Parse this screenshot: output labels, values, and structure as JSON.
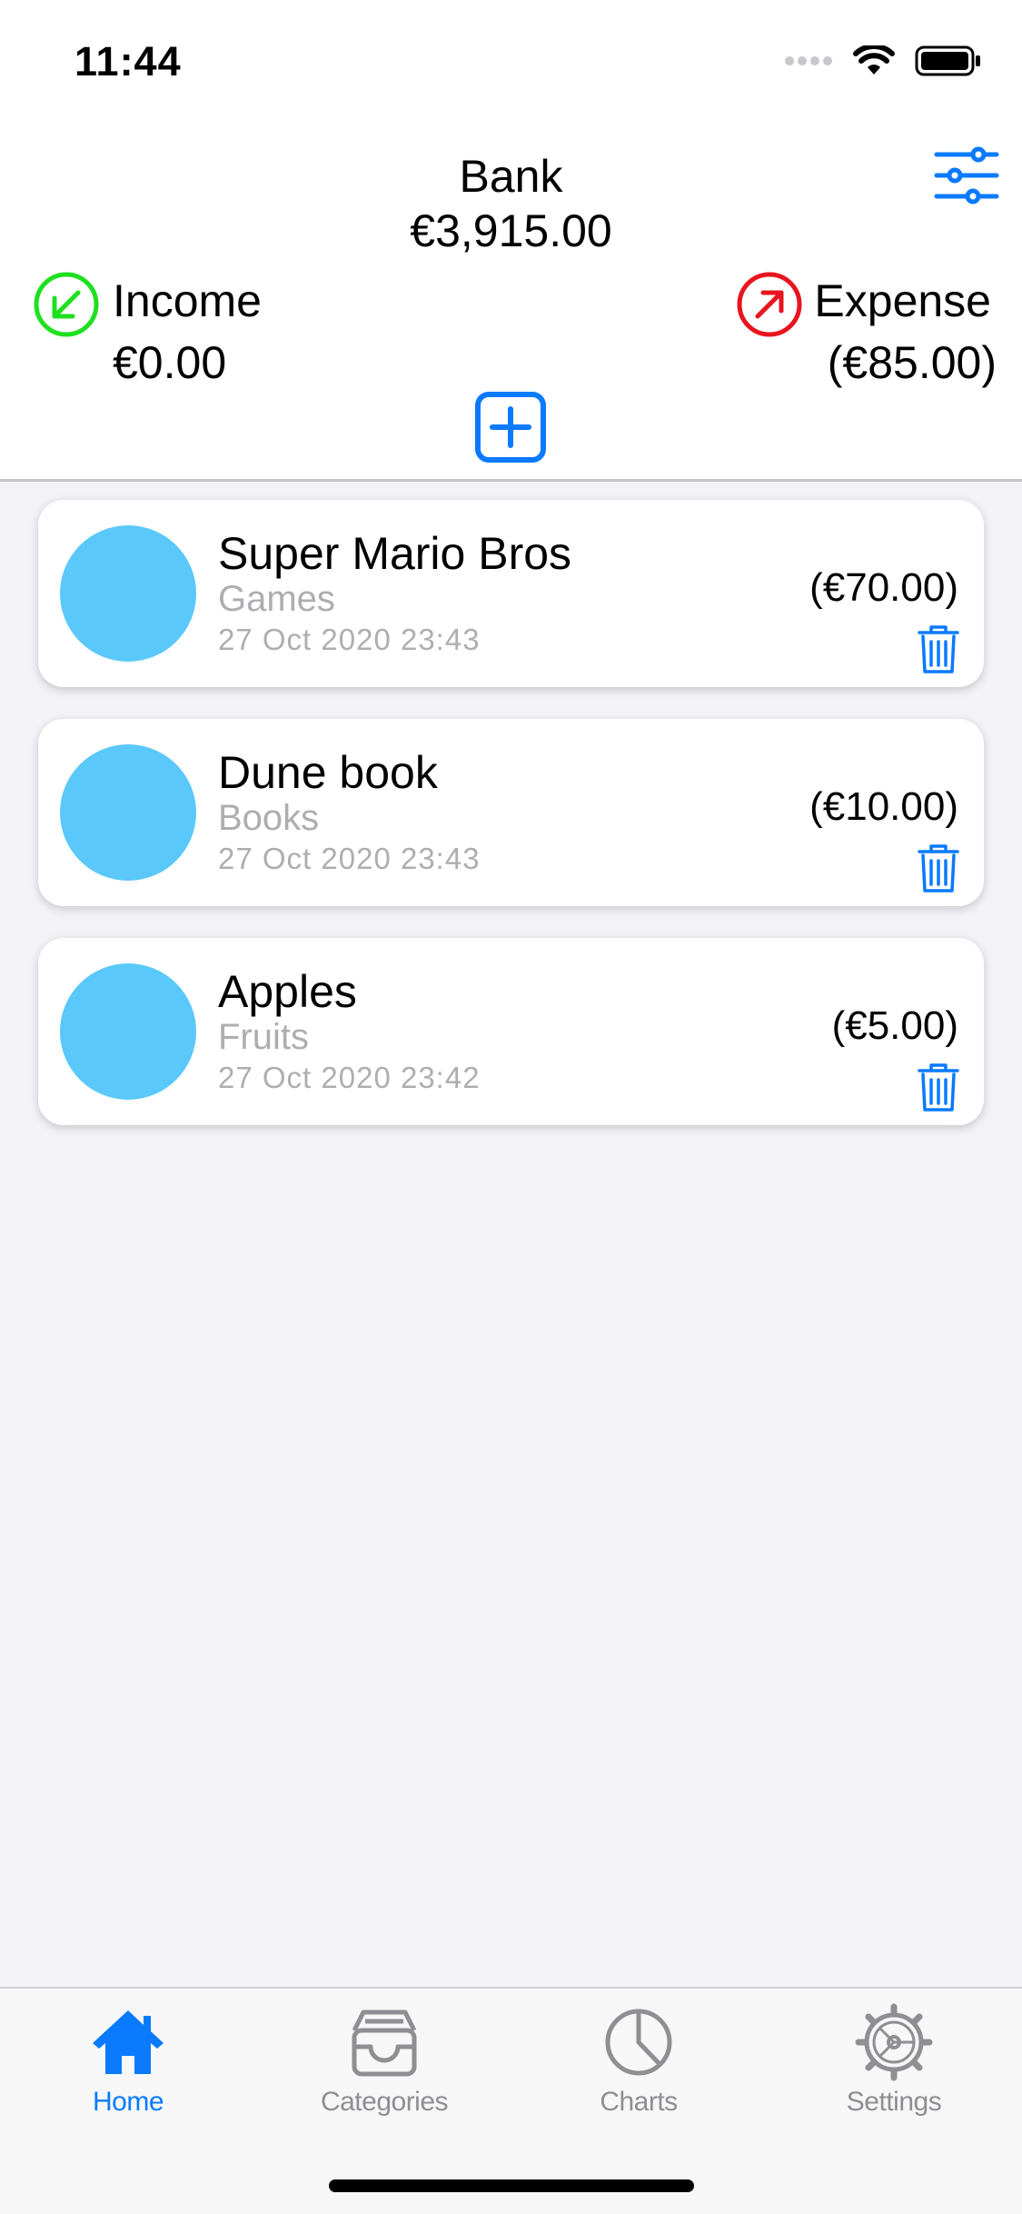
{
  "status": {
    "time": "11:44"
  },
  "header": {
    "account_name": "Bank",
    "account_total": "€3,915.00",
    "income_label": "Income",
    "income_value": "€0.00",
    "expense_label": "Expense",
    "expense_value": "(€85.00)"
  },
  "transactions": [
    {
      "name": "Super Mario Bros",
      "category": "Games",
      "date": "27 Oct 2020 23:43",
      "amount": "(€70.00)"
    },
    {
      "name": "Dune book",
      "category": "Books",
      "date": "27 Oct 2020 23:43",
      "amount": "(€10.00)"
    },
    {
      "name": "Apples",
      "category": "Fruits",
      "date": "27 Oct 2020 23:42",
      "amount": "(€5.00)"
    }
  ],
  "tabs": [
    {
      "label": "Home",
      "icon": "house-icon",
      "active": true
    },
    {
      "label": "Categories",
      "icon": "tray-icon",
      "active": false
    },
    {
      "label": "Charts",
      "icon": "pie-chart-icon",
      "active": false
    },
    {
      "label": "Settings",
      "icon": "gear-icon",
      "active": false
    }
  ],
  "colors": {
    "accent": "#0a7aff",
    "income": "#1ee01e",
    "expense": "#e8141e",
    "avatar": "#5ac8fa"
  }
}
